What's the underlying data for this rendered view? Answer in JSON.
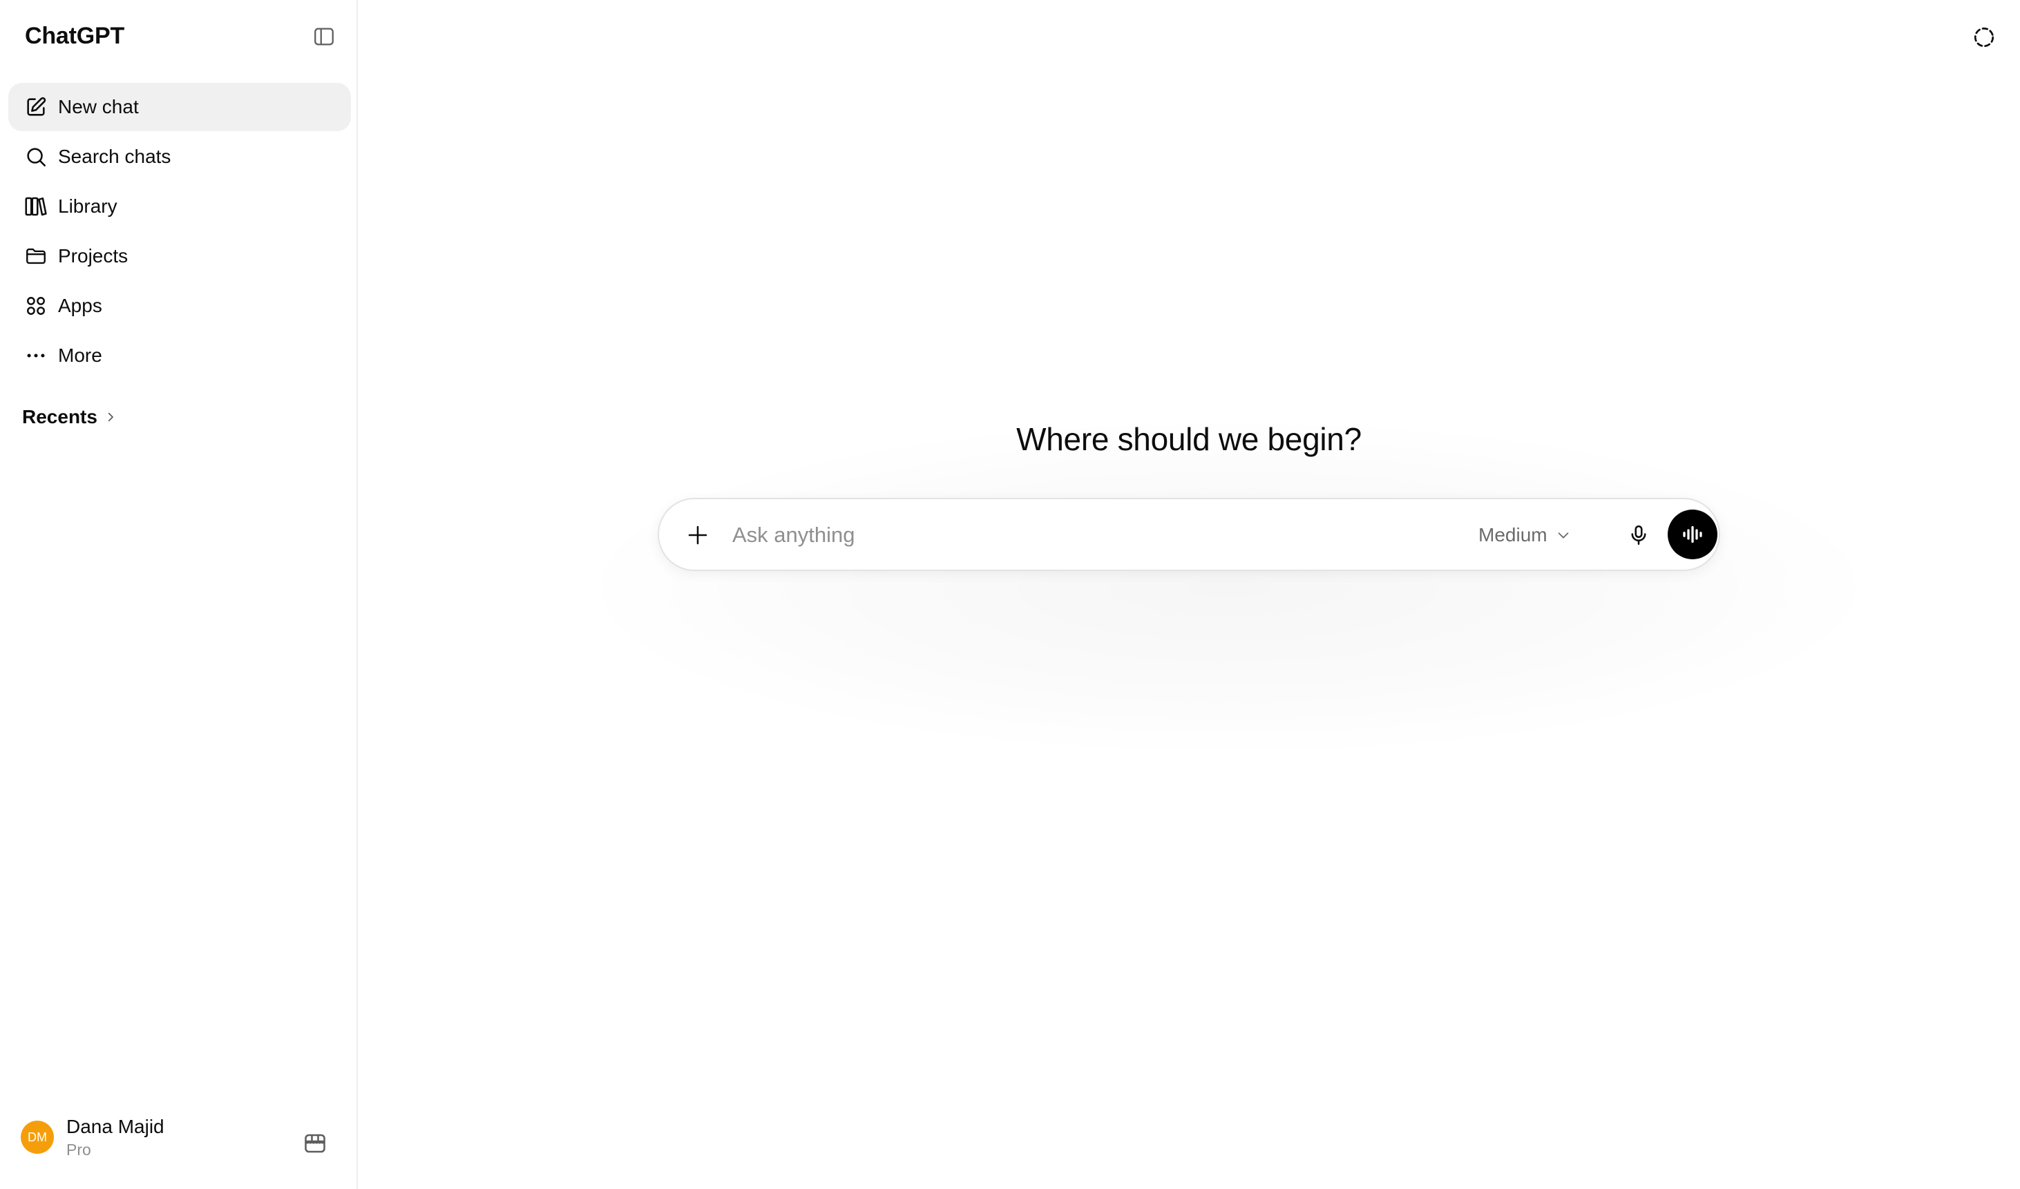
{
  "sidebar": {
    "brand": "ChatGPT",
    "nav": [
      {
        "label": "New chat",
        "icon": "new-chat-icon",
        "active": true
      },
      {
        "label": "Search chats",
        "icon": "search-icon"
      },
      {
        "label": "Library",
        "icon": "library-icon"
      },
      {
        "label": "Projects",
        "icon": "folder-icon"
      },
      {
        "label": "Apps",
        "icon": "apps-grid-icon"
      },
      {
        "label": "More",
        "icon": "more-dots-icon"
      }
    ],
    "recents_label": "Recents",
    "user": {
      "initials": "DM",
      "name": "Dana Majid",
      "plan": "Pro",
      "avatar_color": "#f59e0b"
    }
  },
  "main": {
    "headline": "Where should we begin?",
    "composer": {
      "placeholder": "Ask anything",
      "value": "",
      "model": "Medium"
    }
  },
  "colors": {
    "accent_dark": "#000000",
    "active_item_bg": "#f0f0f0",
    "muted_text": "#8f8f8f"
  }
}
